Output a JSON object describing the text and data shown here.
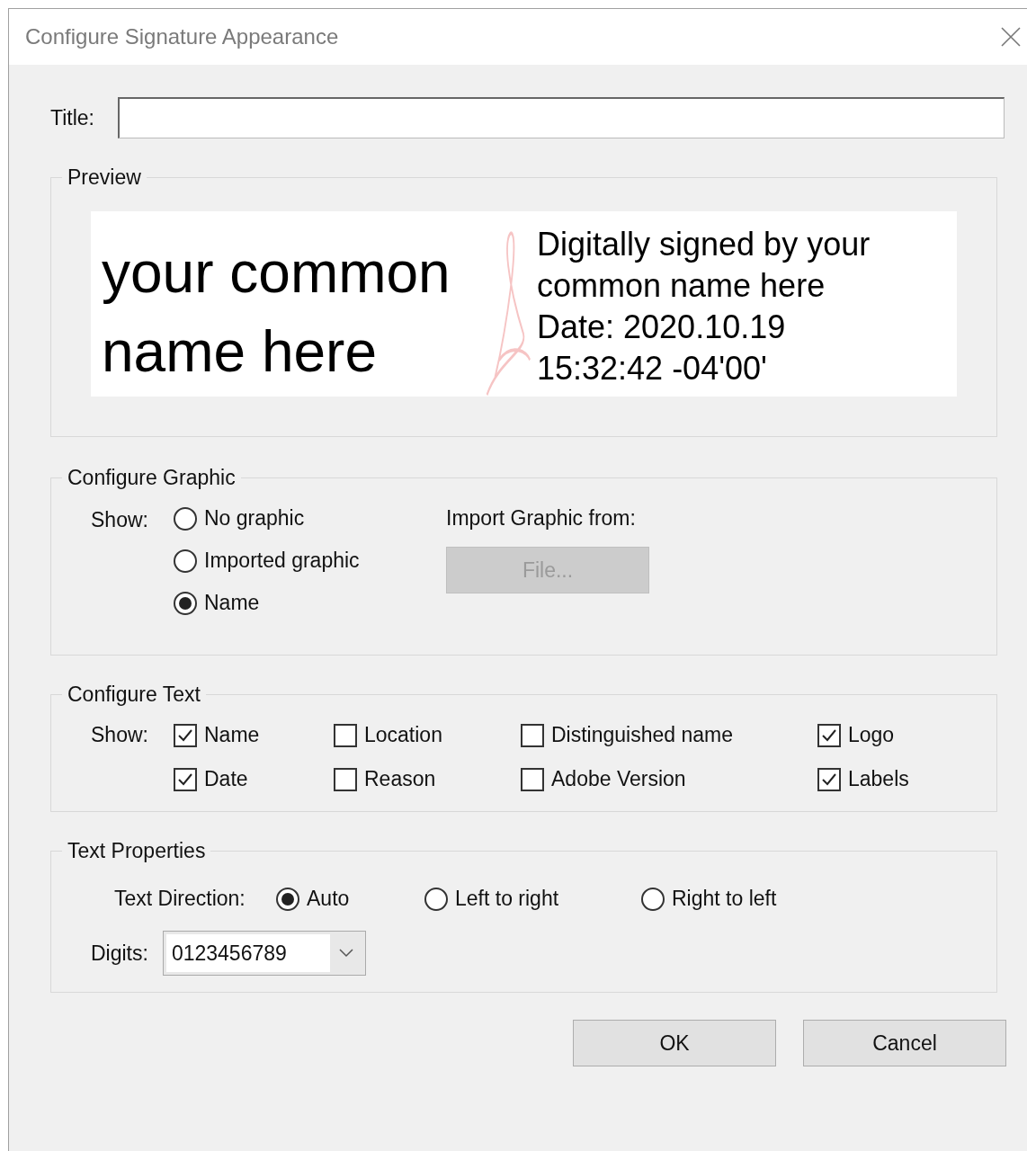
{
  "window": {
    "title": "Configure Signature Appearance"
  },
  "title_field": {
    "label": "Title:"
  },
  "preview": {
    "legend": "Preview",
    "name": "your common name here",
    "details": [
      "Digitally signed by your common name here",
      "Date: 2020.10.19 15:32:42 -04'00'"
    ]
  },
  "configure_graphic": {
    "legend": "Configure Graphic",
    "show_label": "Show:",
    "options": [
      {
        "label": "No graphic",
        "selected": false
      },
      {
        "label": "Imported graphic",
        "selected": false
      },
      {
        "label": "Name",
        "selected": true
      }
    ],
    "import_label": "Import Graphic from:",
    "file_button": {
      "label": "File...",
      "disabled": true
    }
  },
  "configure_text": {
    "legend": "Configure Text",
    "show_label": "Show:",
    "options": [
      {
        "label": "Name",
        "checked": true
      },
      {
        "label": "Location",
        "checked": false
      },
      {
        "label": "Distinguished name",
        "checked": false
      },
      {
        "label": "Logo",
        "checked": true
      },
      {
        "label": "Date",
        "checked": true
      },
      {
        "label": "Reason",
        "checked": false
      },
      {
        "label": "Adobe Version",
        "checked": false
      },
      {
        "label": "Labels",
        "checked": true
      }
    ]
  },
  "text_properties": {
    "legend": "Text Properties",
    "direction": {
      "label": "Text Direction:",
      "options": [
        {
          "label": "Auto",
          "selected": true
        },
        {
          "label": "Left to right",
          "selected": false
        },
        {
          "label": "Right to left",
          "selected": false
        }
      ]
    },
    "digits": {
      "label": "Digits:",
      "value": "0123456789"
    }
  },
  "buttons": [
    {
      "label": "OK"
    },
    {
      "label": "Cancel"
    }
  ]
}
